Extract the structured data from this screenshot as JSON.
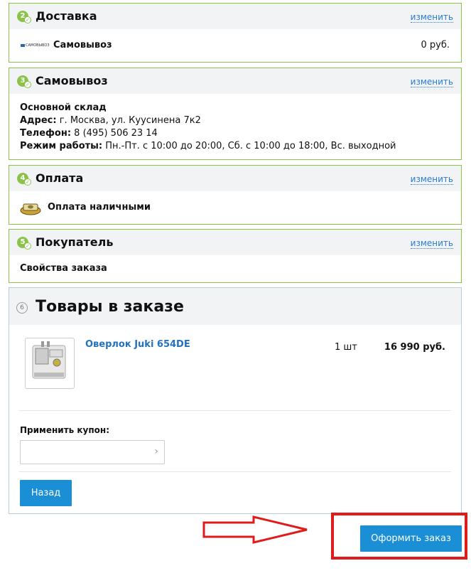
{
  "delivery": {
    "number": "2",
    "title": "Доставка",
    "change_label": "изменить",
    "logo_text": "САМОВЫВОЗ",
    "method": "Самовывоз",
    "price": "0 руб."
  },
  "pickup": {
    "number": "3",
    "title": "Самовывоз",
    "change_label": "изменить",
    "store_name": "Основной склад",
    "address_label": "Адрес:",
    "address_value": " г. Москва, ул. Куусинена 7к2",
    "phone_label": "Телефон:",
    "phone_value": " 8 (495) 506 23 14",
    "hours_label": "Режим работы:",
    "hours_value": " Пн.-Пт. с 10:00 до 20:00, Сб. с 10:00 до 18:00, Вс. выходной"
  },
  "payment": {
    "number": "4",
    "title": "Оплата",
    "change_label": "изменить",
    "method": "Оплата наличными"
  },
  "buyer": {
    "number": "5",
    "title": "Покупатель",
    "change_label": "изменить",
    "content": "Свойства заказа"
  },
  "cart": {
    "number": "6",
    "title": "Товары в заказе",
    "items": [
      {
        "name": "Оверлок Juki 654DE",
        "quantity": "1 шт",
        "price": "16 990 руб."
      }
    ],
    "coupon_label": "Применить купон:",
    "coupon_placeholder": "",
    "back_label": "Назад"
  },
  "submit_label": "Оформить заказ",
  "colors": {
    "accent": "#1b8fd6",
    "section_border": "#8bc34a",
    "highlight_frame": "#e01b1b"
  }
}
